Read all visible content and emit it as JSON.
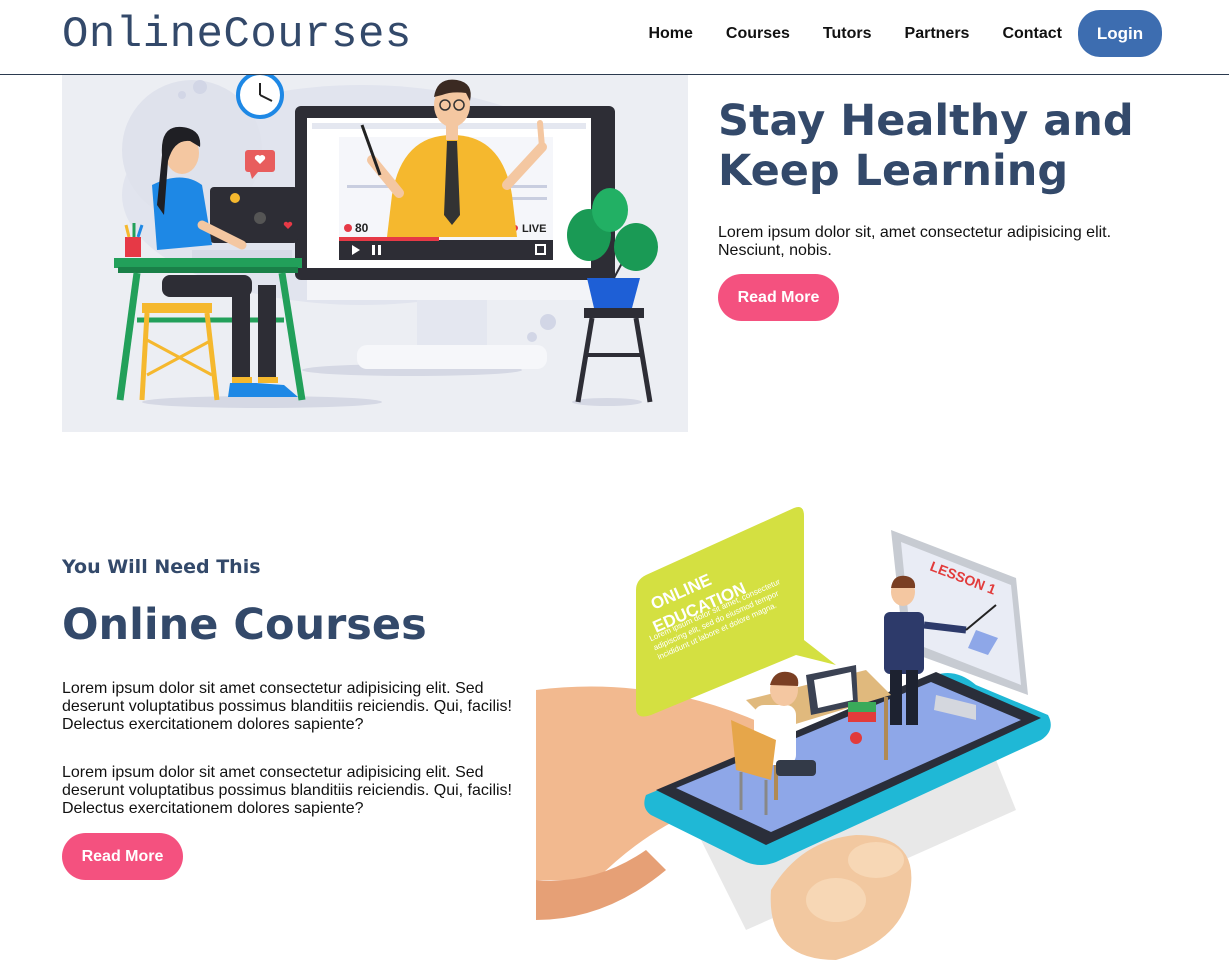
{
  "header": {
    "logo": "OnlineCourses",
    "nav": [
      "Home",
      "Courses",
      "Tutors",
      "Partners",
      "Contact"
    ],
    "login_label": "Login"
  },
  "hero": {
    "title": "Stay Healthy and Keep Learning",
    "text": "Lorem ipsum dolor sit, amet consectetur adipisicing elit. Nesciunt, nobis.",
    "button_label": "Read More",
    "illustration": {
      "viewer_count": "80",
      "live_label": "LIVE"
    }
  },
  "courses": {
    "subtitle": "You Will Need This",
    "title": "Online Courses",
    "paragraphs": [
      "Lorem ipsum dolor sit amet consectetur adipisicing elit. Sed deserunt voluptatibus possimus blanditiis reiciendis. Qui, facilis! Delectus exercitationem dolores sapiente?",
      "Lorem ipsum dolor sit amet consectetur adipisicing elit. Sed deserunt voluptatibus possimus blanditiis reiciendis. Qui, facilis! Delectus exercitationem dolores sapiente?"
    ],
    "button_label": "Read More",
    "illustration": {
      "bubble_title_1": "ONLINE",
      "bubble_title_2": "EDUCATION",
      "bubble_text": "Lorem ipsum dolor sit amet, consectetur adipiscing elit, sed do eiusmod tempor incididunt ut labore et dolore magna.",
      "screen_label": "LESSON 1"
    }
  },
  "colors": {
    "brand": "#33496a",
    "login": "#3d6db0",
    "accent": "#f4517f"
  }
}
